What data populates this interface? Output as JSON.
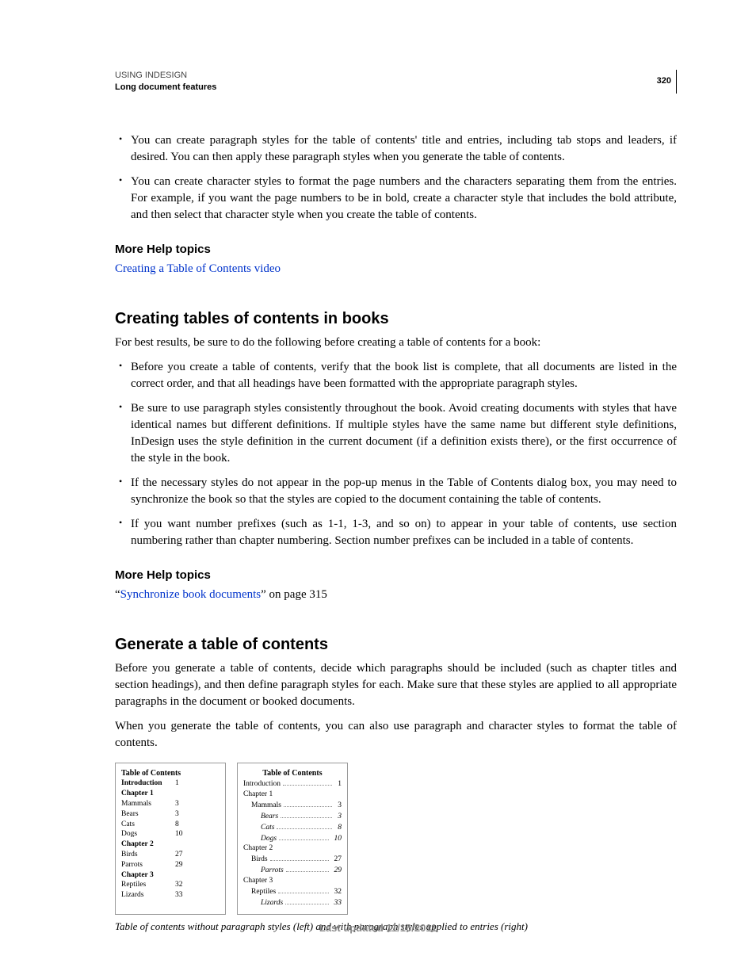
{
  "header": {
    "doc_title": "USING INDESIGN",
    "section": "Long document features",
    "page_number": "320"
  },
  "intro_bullets": [
    "You can create paragraph styles for the table of contents' title and entries, including tab stops and leaders, if desired. You can then apply these paragraph styles when you generate the table of contents.",
    "You can create character styles to format the page numbers and the characters separating them from the entries. For example, if you want the page numbers to be in bold, create a character style that includes the bold attribute, and then select that character style when you create the table of contents."
  ],
  "help1": {
    "heading": "More Help topics",
    "link": "Creating a Table of Contents video"
  },
  "sec1": {
    "title": "Creating tables of contents in books",
    "intro": "For best results, be sure to do the following before creating a table of contents for a book:",
    "bullets": [
      "Before you create a table of contents, verify that the book list is complete, that all documents are listed in the correct order, and that all headings have been formatted with the appropriate paragraph styles.",
      "Be sure to use paragraph styles consistently throughout the book. Avoid creating documents with styles that have identical names but different definitions. If multiple styles have the same name but different style definitions, InDesign uses the style definition in the current document (if a definition exists there), or the first occurrence of the style in the book.",
      "If the necessary styles do not appear in the pop-up menus in the Table of Contents dialog box, you may need to synchronize the book so that the styles are copied to the document containing the table of contents.",
      "If you want number prefixes (such as 1-1, 1-3, and so on) to appear in your table of contents, use section numbering rather than chapter numbering. Section number prefixes can be included in a table of contents."
    ]
  },
  "help2": {
    "heading": "More Help topics",
    "quote_open": "“",
    "link": "Synchronize book documents",
    "quote_tail": "” on page 315"
  },
  "sec2": {
    "title": "Generate a table of contents",
    "p1": "Before you generate a table of contents, decide which paragraphs should be included (such as chapter titles and section headings), and then define paragraph styles for each. Make sure that these styles are applied to all appropriate paragraphs in the document or booked documents.",
    "p2": "When you generate the table of contents, you can also use paragraph and character styles to format the table of contents."
  },
  "figure": {
    "title": "Table of Contents",
    "left": [
      {
        "label": "Introduction",
        "page": "1",
        "bold": true
      },
      {
        "label": "Chapter 1",
        "page": "",
        "bold": true
      },
      {
        "label": "Mammals",
        "page": "3"
      },
      {
        "label": "Bears",
        "page": "3"
      },
      {
        "label": "Cats",
        "page": "8"
      },
      {
        "label": "Dogs",
        "page": "10"
      },
      {
        "label": "Chapter 2",
        "page": "",
        "bold": true
      },
      {
        "label": "Birds",
        "page": "27"
      },
      {
        "label": "Parrots",
        "page": "29"
      },
      {
        "label": "Chapter 3",
        "page": "",
        "bold": true
      },
      {
        "label": "Reptiles",
        "page": "32"
      },
      {
        "label": "Lizards",
        "page": "33"
      }
    ],
    "right": [
      {
        "label": "Introduction",
        "page": "1",
        "indent": 0,
        "leader": true
      },
      {
        "label": "Chapter 1",
        "page": "",
        "indent": 0
      },
      {
        "label": "Mammals",
        "page": "3",
        "indent": 1,
        "leader": true
      },
      {
        "label": "Bears",
        "page": "3",
        "indent": 2,
        "leader": true
      },
      {
        "label": "Cats",
        "page": "8",
        "indent": 2,
        "leader": true
      },
      {
        "label": "Dogs",
        "page": "10",
        "indent": 2,
        "leader": true
      },
      {
        "label": "Chapter 2",
        "page": "",
        "indent": 0
      },
      {
        "label": "Birds",
        "page": "27",
        "indent": 1,
        "leader": true
      },
      {
        "label": "Parrots",
        "page": "29",
        "indent": 2,
        "leader": true
      },
      {
        "label": "Chapter 3",
        "page": "",
        "indent": 0
      },
      {
        "label": "Reptiles",
        "page": "32",
        "indent": 1,
        "leader": true
      },
      {
        "label": "Lizards",
        "page": "33",
        "indent": 2,
        "leader": true
      }
    ],
    "caption": "Table of contents without paragraph styles (left) and with paragraph styles applied to entries (right)"
  },
  "footer": "Last updated 11/16/2011"
}
